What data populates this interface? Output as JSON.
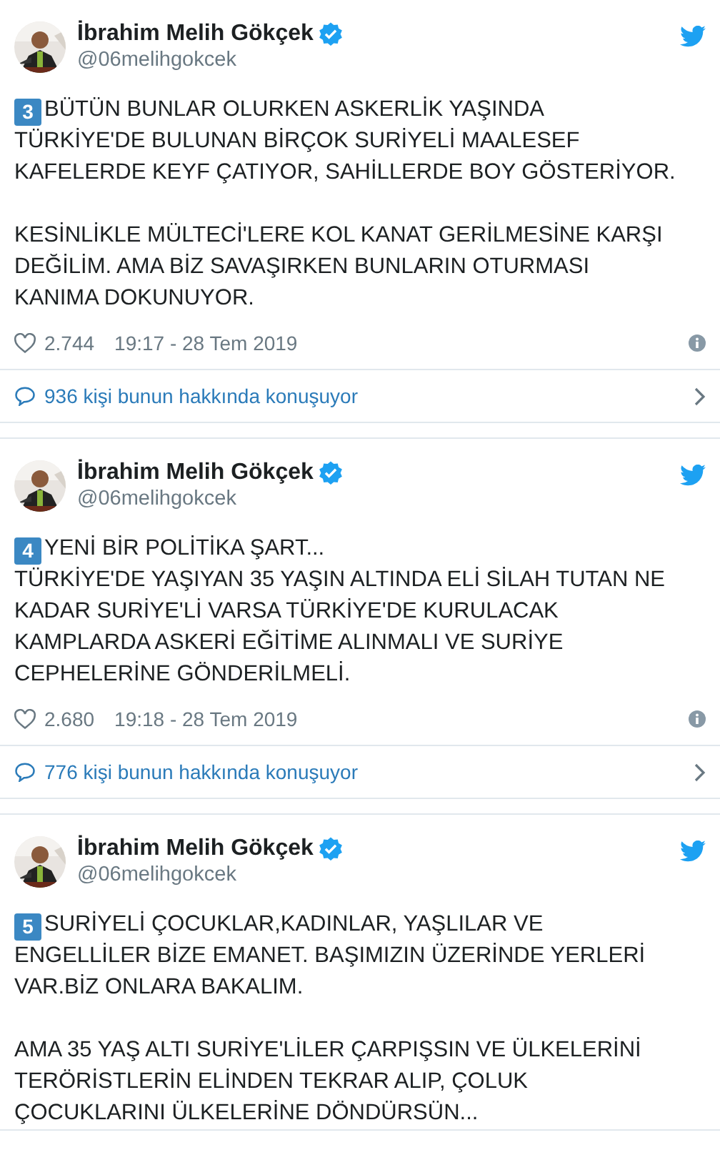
{
  "tweets": [
    {
      "author": {
        "name": "İbrahim Melih Gökçek",
        "handle": "@06melihgokcek",
        "verified": true
      },
      "number": "3",
      "paragraphs": [
        "BÜTÜN BUNLAR OLURKEN ASKERLİK YAŞINDA\nTÜRKİYE'DE BULUNAN BİRÇOK SURİYELİ MAALESEF\nKAFELERDE KEYF ÇATIYOR, SAHİLLERDE BOY GÖSTERİYOR.",
        "KESİNLİKLE MÜLTECİ'LERE KOL KANAT GERİLMESİNE KARŞI\nDEĞİLİM. AMA BİZ SAVAŞIRKEN BUNLARIN OTURMASI\nKANIMA DOKUNUYOR."
      ],
      "likes": "2.744",
      "time": "19:17 - 28 Tem 2019",
      "conversation": "936 kişi bunun hakkında konuşuyor"
    },
    {
      "author": {
        "name": "İbrahim Melih Gökçek",
        "handle": "@06melihgokcek",
        "verified": true
      },
      "number": "4",
      "paragraphs": [
        "YENİ BİR POLİTİKA ŞART...\nTÜRKİYE'DE YAŞIYAN 35 YAŞIN ALTINDA ELİ SİLAH TUTAN NE\nKADAR SURİYE'Lİ VARSA TÜRKİYE'DE KURULACAK\nKAMPLARDA ASKERİ EĞİTİME ALINMALI VE SURİYE\nCEPHELERİNE GÖNDERİLMELİ."
      ],
      "likes": "2.680",
      "time": "19:18 - 28 Tem 2019",
      "conversation": "776 kişi bunun hakkında konuşuyor"
    },
    {
      "author": {
        "name": "İbrahim Melih Gökçek",
        "handle": "@06melihgokcek",
        "verified": true
      },
      "number": "5",
      "paragraphs": [
        "SURİYELİ ÇOCUKLAR,KADINLAR, YAŞLILAR VE\nENGELLİLER BİZE EMANET. BAŞIMIZIN ÜZERİNDE YERLERİ\nVAR.BİZ ONLARA BAKALIM.",
        "AMA 35 YAŞ ALTI SURİYE'LİLER ÇARPIŞSIN VE ÜLKELERİNİ\nTERÖRİSTLERİN ELİNDEN TEKRAR ALIP, ÇOLUK\nÇOCUKLARINI ÜLKELERİNE DÖNDÜRSÜN..."
      ]
    }
  ]
}
